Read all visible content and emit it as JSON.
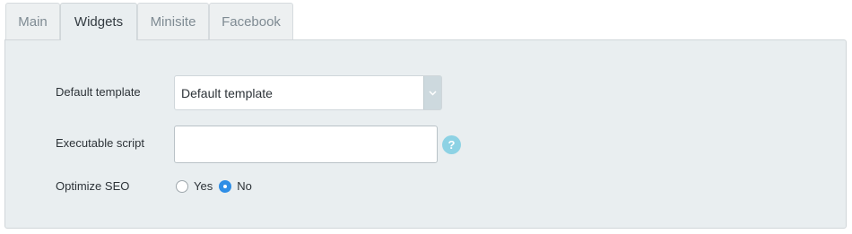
{
  "tabs": [
    {
      "label": "Main",
      "active": false
    },
    {
      "label": "Widgets",
      "active": true
    },
    {
      "label": "Minisite",
      "active": false
    },
    {
      "label": "Facebook",
      "active": false
    }
  ],
  "form": {
    "template": {
      "label": "Default template",
      "value": "Default template"
    },
    "script": {
      "label": "Executable script",
      "value": "",
      "placeholder": "",
      "help_symbol": "?"
    },
    "seo": {
      "label": "Optimize SEO",
      "options": [
        {
          "label": "Yes",
          "checked": false
        },
        {
          "label": "No",
          "checked": true
        }
      ]
    }
  },
  "colors": {
    "panel_bg": "#e9eef0",
    "help_icon": "#8dd2e4",
    "radio_checked": "#2f8ee6"
  },
  "icons": {
    "select_arrow": "chevron-down-icon",
    "help": "help-icon"
  }
}
